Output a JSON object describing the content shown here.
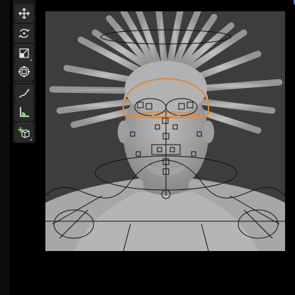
{
  "colors": {
    "background": "#000000",
    "toolbar": "#1b1b1b",
    "tool_button": "#2a2a2a",
    "icon": "#e0e0e0",
    "accent_green": "#7fd36a",
    "accent_blue": "#2f6bd8",
    "viewport_bg": "#3d3d3d",
    "selection_orange": "#e08a3a"
  },
  "toolbar": {
    "tools": [
      {
        "icon": "move-icon"
      },
      {
        "icon": "rotate-icon"
      },
      {
        "icon": "scale-icon"
      },
      {
        "icon": "transform-icon"
      },
      {
        "icon": "annotate-icon"
      },
      {
        "icon": "measure-icon"
      },
      {
        "icon": "add-cube-icon"
      }
    ]
  },
  "viewport": {
    "subject": "3d-head-model-with-rig"
  }
}
